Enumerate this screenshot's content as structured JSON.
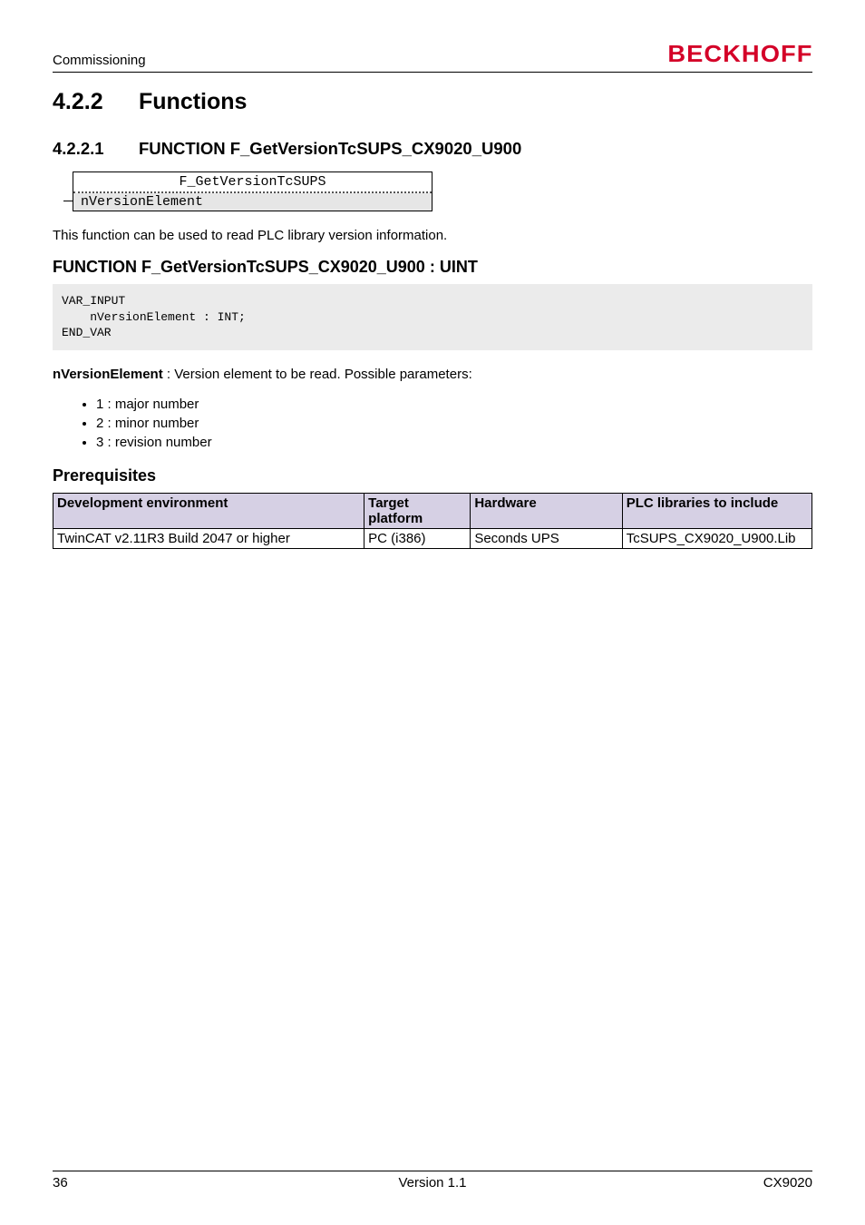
{
  "header": {
    "section_label": "Commissioning",
    "logo_text": "BECKHOFF"
  },
  "h2": {
    "num": "4.2.2",
    "title": "Functions"
  },
  "h3": {
    "num": "4.2.2.1",
    "title": "FUNCTION F_GetVersionTcSUPS_CX9020_U900"
  },
  "fb": {
    "title": "F_GetVersionTcSUPS",
    "input": "nVersionElement"
  },
  "p_intro": "This function can be used to read PLC library version information.",
  "fn_sig": "FUNCTION F_GetVersionTcSUPS_CX9020_U900 : UINT",
  "code": "VAR_INPUT\n    nVersionElement : INT;\nEND_VAR",
  "param_label_strong": "nVersionElement",
  "param_label_rest": " : Version element to be read. Possible parameters:",
  "bullets": [
    "1 : major number",
    "2 : minor number",
    "3 : revision number"
  ],
  "prereq_heading": "Prerequisites",
  "table": {
    "headers": {
      "env": "Development environment",
      "plat": "Target platform",
      "hw": "Hardware",
      "lib": "PLC libraries to include"
    },
    "row": {
      "env": "TwinCAT v2.11R3 Build 2047 or higher",
      "plat": "PC (i386)",
      "hw": "Seconds UPS",
      "lib": "TcSUPS_CX9020_U900.Lib"
    }
  },
  "footer": {
    "left": "36",
    "center": "Version 1.1",
    "right": "CX9020"
  }
}
